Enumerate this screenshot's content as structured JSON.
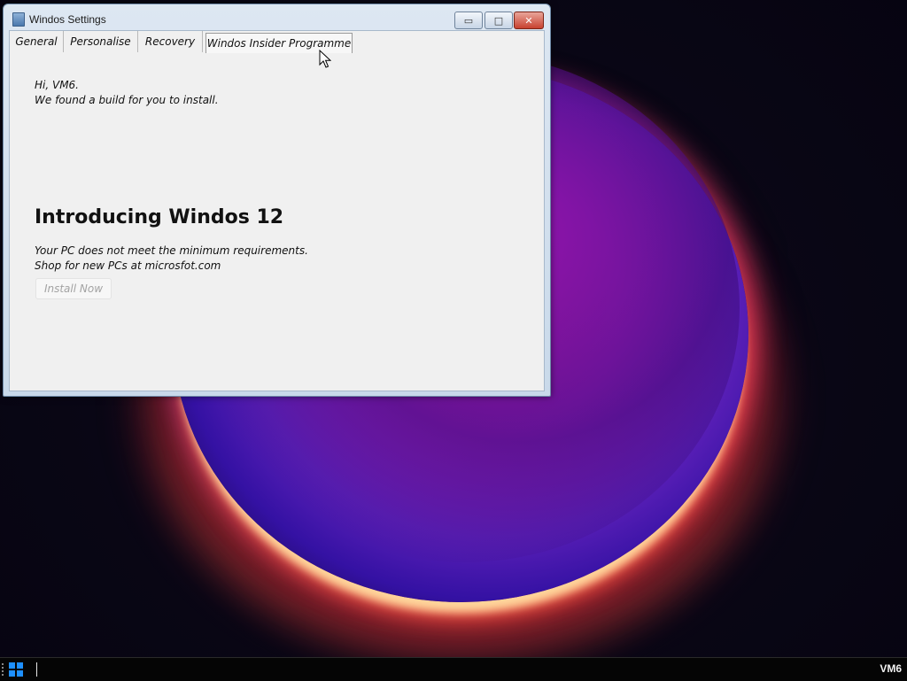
{
  "window": {
    "title": "Windos Settings",
    "minimize_glyph": "▭",
    "maximize_glyph": "□",
    "close_glyph": "✕"
  },
  "tabs": [
    {
      "label": "General"
    },
    {
      "label": "Personalise"
    },
    {
      "label": "Recovery"
    },
    {
      "label": "Windos Insider Programme",
      "active": true
    }
  ],
  "insider": {
    "greeting_line1": "Hi, VM6.",
    "greeting_line2": "We found a build for you to install.",
    "heading": "Introducing Windos 12",
    "req_line1": "Your PC does not meet the minimum requirements.",
    "req_line2": "Shop for new PCs at microsfot.com",
    "install_label": "Install Now"
  },
  "taskbar": {
    "tray_label": "VM6"
  },
  "colors": {
    "start_logo": "#1e90ff",
    "close_button": "#c8412f"
  }
}
